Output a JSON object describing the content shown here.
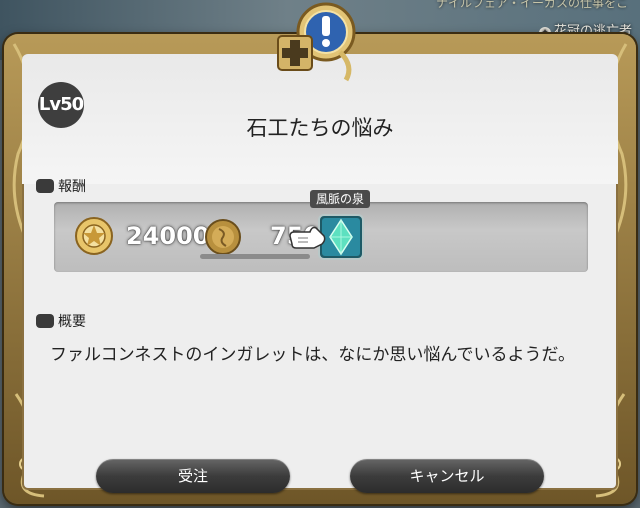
{
  "background": {
    "location_hint": "花冠の逃亡者",
    "top_text": "ナイルフェア・イーガスの仕事をこ"
  },
  "quest": {
    "level": "Lv50",
    "title": "石工たちの悩み"
  },
  "reward": {
    "label": "報酬",
    "gil": "24000",
    "seals": "750",
    "item_tooltip": "風脈の泉"
  },
  "summary": {
    "label": "概要",
    "text": "ファルコンネストのインガレットは、なにか思い悩んでいるようだ。"
  },
  "buttons": {
    "accept": "受注",
    "cancel": "キャンセル"
  },
  "colors": {
    "frame_gold": "#b89a58",
    "panel_bg": "#eeeeee",
    "button_dark": "#3c3c3c",
    "aether_cyan": "#39c4d6"
  }
}
